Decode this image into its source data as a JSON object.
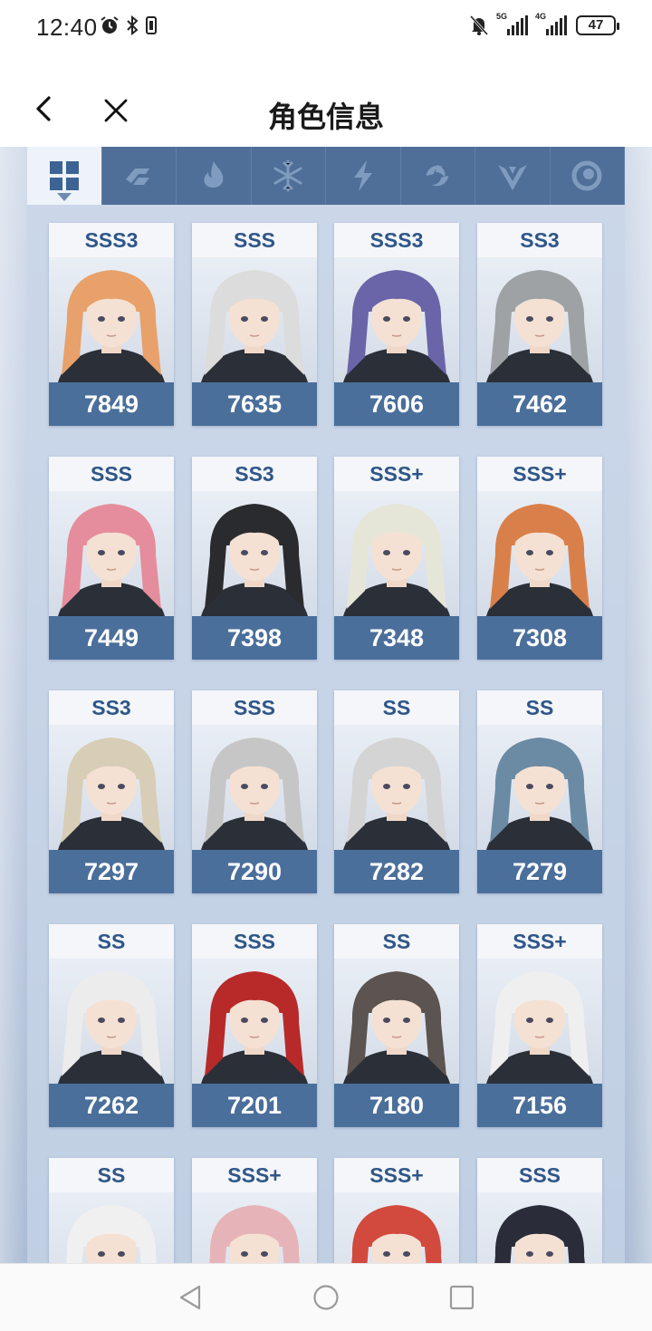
{
  "status_bar": {
    "time": "12:40",
    "sim1_label": "5G",
    "sim2_label": "4G",
    "battery": "47",
    "icons": [
      "alarm-icon",
      "bluetooth-icon",
      "vibrate-icon",
      "mute-icon",
      "signal-icon"
    ]
  },
  "header": {
    "title": "角色信息",
    "back_icon": "chevron-left-icon",
    "close_icon": "close-icon"
  },
  "filters": [
    {
      "icon": "grid-all-icon",
      "active": true
    },
    {
      "icon": "physical-element-icon",
      "active": false
    },
    {
      "icon": "fire-element-icon",
      "active": false
    },
    {
      "icon": "ice-element-icon",
      "active": false
    },
    {
      "icon": "lightning-element-icon",
      "active": false
    },
    {
      "icon": "wind-element-icon",
      "active": false
    },
    {
      "icon": "dark-element-icon",
      "active": false
    },
    {
      "icon": "light-element-icon",
      "active": false
    }
  ],
  "characters": [
    {
      "rank": "SSS3",
      "power": "7849",
      "hair": "#e8a16a"
    },
    {
      "rank": "SSS",
      "power": "7635",
      "hair": "#dcdcdc"
    },
    {
      "rank": "SSS3",
      "power": "7606",
      "hair": "#6a64a8"
    },
    {
      "rank": "SS3",
      "power": "7462",
      "hair": "#9ea2a4"
    },
    {
      "rank": "SSS",
      "power": "7449",
      "hair": "#e58d9c"
    },
    {
      "rank": "SS3",
      "power": "7398",
      "hair": "#2a2b2e"
    },
    {
      "rank": "SSS+",
      "power": "7348",
      "hair": "#e6e6d8"
    },
    {
      "rank": "SSS+",
      "power": "7308",
      "hair": "#d9804a"
    },
    {
      "rank": "SS3",
      "power": "7297",
      "hair": "#d8cdb6"
    },
    {
      "rank": "SSS",
      "power": "7290",
      "hair": "#c6c6c6"
    },
    {
      "rank": "SS",
      "power": "7282",
      "hair": "#d4d4d4"
    },
    {
      "rank": "SS",
      "power": "7279",
      "hair": "#6b8aa4"
    },
    {
      "rank": "SS",
      "power": "7262",
      "hair": "#ececec"
    },
    {
      "rank": "SSS",
      "power": "7201",
      "hair": "#b82a2a"
    },
    {
      "rank": "SS",
      "power": "7180",
      "hair": "#5b5450"
    },
    {
      "rank": "SSS+",
      "power": "7156",
      "hair": "#efefef"
    },
    {
      "rank": "SS",
      "power": "",
      "hair": "#f0f0f0"
    },
    {
      "rank": "SSS+",
      "power": "",
      "hair": "#e6b4b8"
    },
    {
      "rank": "SSS+",
      "power": "",
      "hair": "#d2493d"
    },
    {
      "rank": "SSS",
      "power": "",
      "hair": "#2a2c3a"
    }
  ],
  "nav_bar": {
    "icons": [
      "nav-back-icon",
      "nav-home-icon",
      "nav-recents-icon"
    ]
  }
}
